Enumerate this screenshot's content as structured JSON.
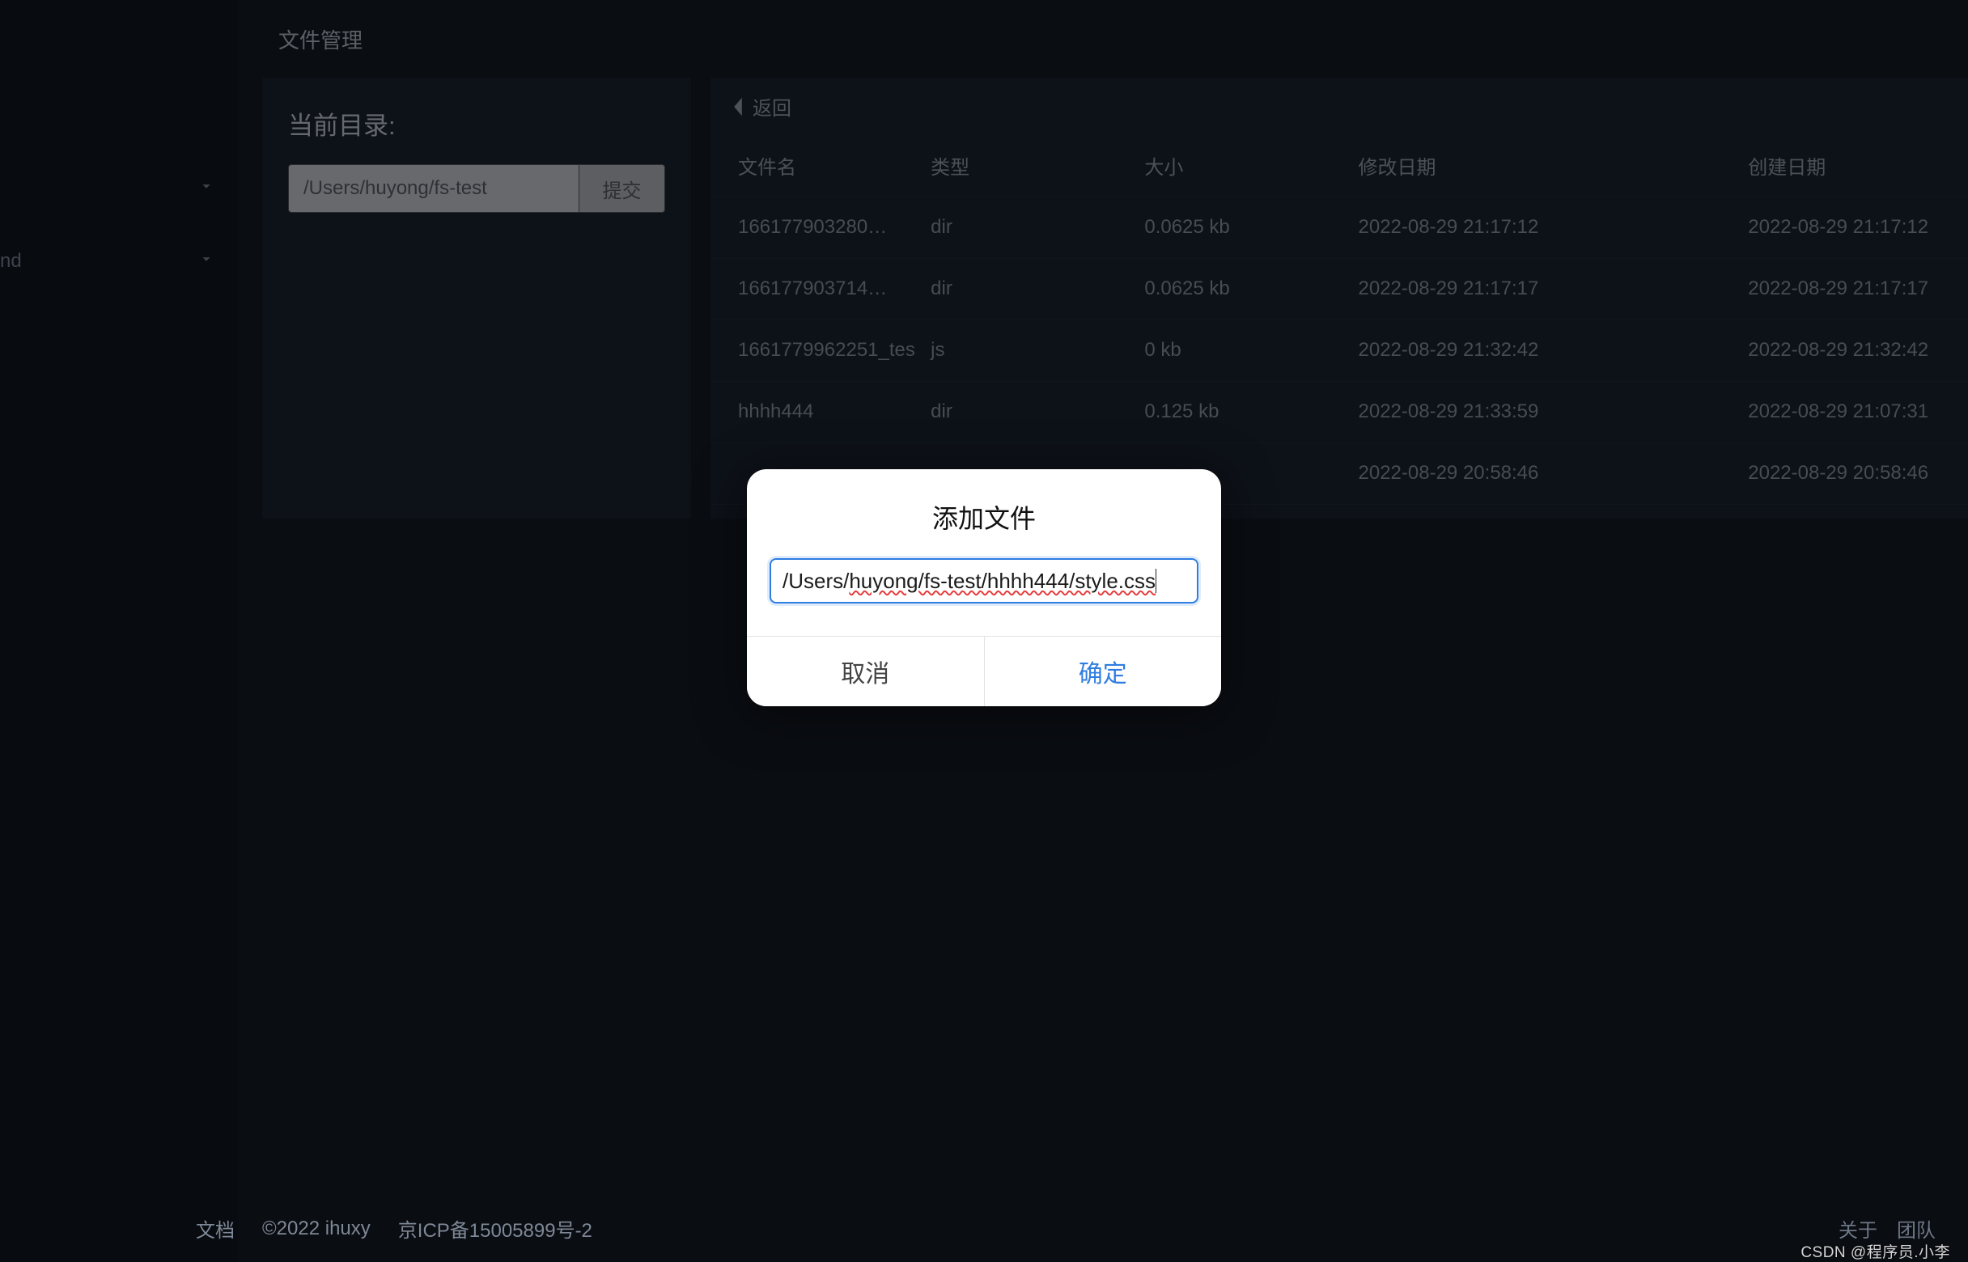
{
  "sidebar": {
    "items": [
      {
        "label": "",
        "has_chevron": false
      },
      {
        "label": "",
        "has_chevron": false
      },
      {
        "label": "",
        "has_chevron": true
      },
      {
        "label": "nd",
        "has_chevron": true
      }
    ]
  },
  "page": {
    "title": "文件管理"
  },
  "dir_panel": {
    "heading": "当前目录:",
    "path_value": "/Users/huyong/fs-test",
    "submit_label": "提交"
  },
  "table": {
    "back_label": "返回",
    "columns": [
      "文件名",
      "类型",
      "大小",
      "修改日期",
      "创建日期"
    ],
    "rows": [
      {
        "name": "16617790328​0…",
        "type": "dir",
        "size": "0.0625 kb",
        "modified": "2022-08-29 21:17:12",
        "created": "2022-08-29 21:17:12"
      },
      {
        "name": "16617790371​4…",
        "type": "dir",
        "size": "0.0625 kb",
        "modified": "2022-08-29 21:17:17",
        "created": "2022-08-29 21:17:17"
      },
      {
        "name": "1661779962251_tes",
        "type": "js",
        "size": "0 kb",
        "modified": "2022-08-29 21:32:42",
        "created": "2022-08-29 21:32:42"
      },
      {
        "name": "hhhh444",
        "type": "dir",
        "size": "0.125 kb",
        "modified": "2022-08-29 21:33:59",
        "created": "2022-08-29 21:07:31"
      },
      {
        "name": "",
        "type": "",
        "size": "",
        "modified": "2022-08-29 20:58:46",
        "created": "2022-08-29 20:58:46"
      }
    ]
  },
  "modal": {
    "title": "添加文件",
    "input_plain": "/Users/",
    "input_squiggle": "huyong/fs-test/hhhh444/style.css",
    "cancel_label": "取消",
    "ok_label": "确定"
  },
  "footer": {
    "docs": "文档",
    "copyright": "©2022 ihuxy",
    "icp": "京ICP备15005899号-2",
    "right": "关于　团队"
  },
  "watermark": "CSDN @程序员.小李"
}
